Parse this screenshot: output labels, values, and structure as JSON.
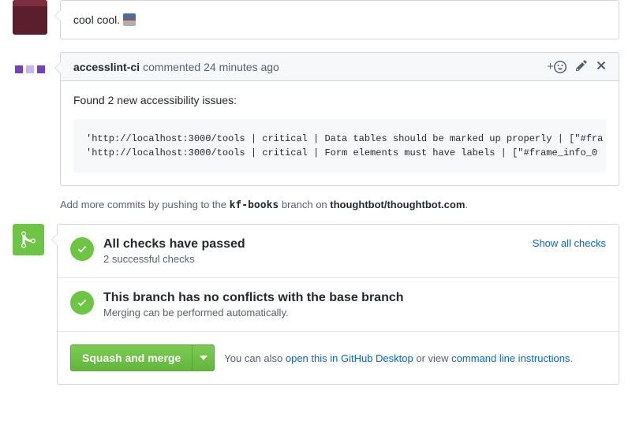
{
  "comment1": {
    "body": "cool cool."
  },
  "comment2": {
    "author": "accesslint-ci",
    "action": "commented",
    "time": "24 minutes ago",
    "react_prefix": "+",
    "body_intro": "Found 2 new accessibility issues:",
    "code": "'http://localhost:3000/tools | critical | Data tables should be marked up properly | [\"#fra\n'http://localhost:3000/tools | critical | Form elements must have labels | [\"#frame_info_0"
  },
  "push_hint": {
    "prefix": "Add more commits by pushing to the ",
    "branch": "kf-books",
    "mid": " branch on ",
    "repo": "thoughtbot/thoughtbot.com",
    "suffix": "."
  },
  "checks": {
    "title": "All checks have passed",
    "sub": "2 successful checks",
    "show_all": "Show all checks"
  },
  "conflicts": {
    "title": "This branch has no conflicts with the base branch",
    "sub": "Merging can be performed automatically."
  },
  "merge_action": {
    "button": "Squash and merge",
    "hint_prefix": "You can also ",
    "desktop_link": "open this in GitHub Desktop",
    "hint_mid": " or view ",
    "cli_link": "command line instructions",
    "hint_suffix": "."
  }
}
